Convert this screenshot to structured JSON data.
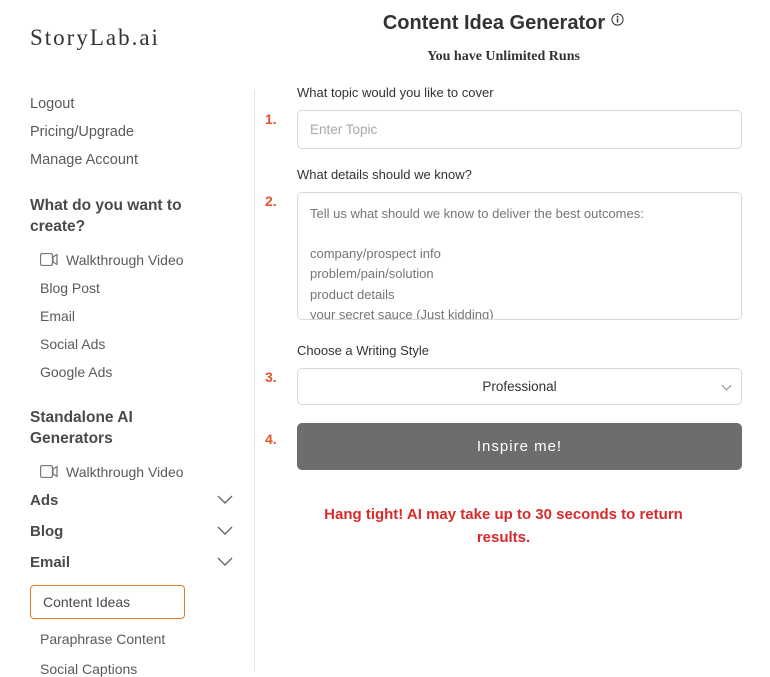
{
  "brand": "StoryLab.ai",
  "account_nav": [
    "Logout",
    "Pricing/Upgrade",
    "Manage Account"
  ],
  "create": {
    "heading": "What do you want to create?",
    "items": [
      {
        "label": "Walkthrough Video",
        "icon": "video"
      },
      {
        "label": "Blog Post"
      },
      {
        "label": "Email"
      },
      {
        "label": "Social Ads"
      },
      {
        "label": "Google Ads"
      }
    ]
  },
  "standalone": {
    "heading": "Standalone AI Generators",
    "walkthrough": "Walkthrough Video",
    "categories": [
      "Ads",
      "Blog",
      "Email"
    ],
    "subitems": [
      {
        "label": "Content Ideas",
        "selected": true
      },
      {
        "label": "Paraphrase Content"
      },
      {
        "label": "Social Captions"
      }
    ]
  },
  "main": {
    "title": "Content Idea Generator",
    "runs": "You have Unlimited Runs",
    "steps_numbers": [
      "1.",
      "2.",
      "3.",
      "4."
    ],
    "topic": {
      "label": "What topic would you like to cover",
      "placeholder": "Enter Topic",
      "value": ""
    },
    "details": {
      "label": "What details should we know?",
      "placeholder": "Tell us what should we know to deliver the best outcomes:\n\ncompany/prospect info\nproblem/pain/solution\nproduct details\nyour secret sauce (Just kidding)",
      "value": ""
    },
    "style": {
      "label": "Choose a Writing Style",
      "selected": "Professional"
    },
    "cta": "Inspire me!",
    "wait": "Hang tight! AI may take up to 30 seconds to return results."
  }
}
